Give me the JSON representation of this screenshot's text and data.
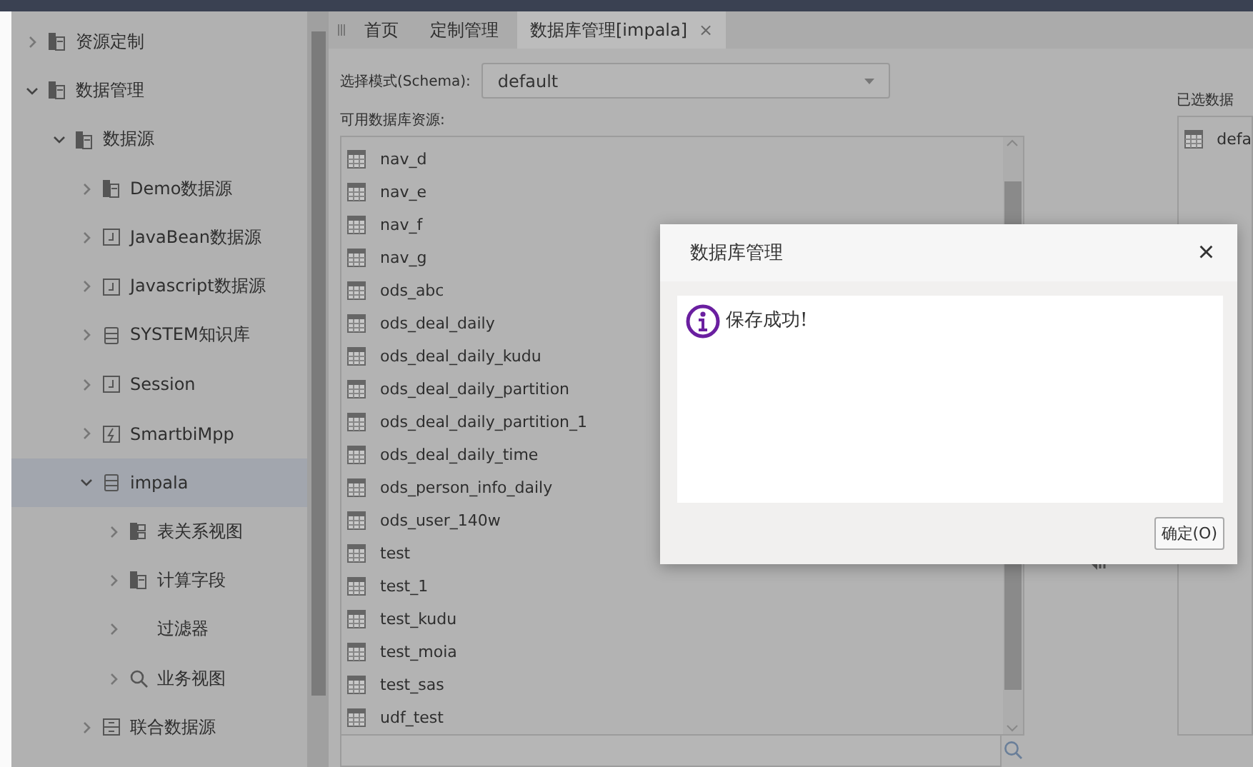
{
  "tree": [
    {
      "label": "资源定制",
      "kind": "folder",
      "expanded": false,
      "selected": false
    },
    {
      "label": "数据管理",
      "kind": "folder",
      "expanded": true,
      "selected": false,
      "children": [
        {
          "label": "数据源",
          "kind": "folder",
          "expanded": true,
          "selected": false,
          "children": [
            {
              "label": "Demo数据源",
              "kind": "folder",
              "expanded": false,
              "selected": false
            },
            {
              "label": "JavaBean数据源",
              "kind": "code",
              "expanded": false,
              "selected": false
            },
            {
              "label": "Javascript数据源",
              "kind": "code",
              "expanded": false,
              "selected": false
            },
            {
              "label": "SYSTEM知识库",
              "kind": "db",
              "expanded": false,
              "selected": false
            },
            {
              "label": "Session",
              "kind": "code",
              "expanded": false,
              "selected": false
            },
            {
              "label": "SmartbiMpp",
              "kind": "bolt",
              "expanded": false,
              "selected": false
            },
            {
              "label": "impala",
              "kind": "db",
              "expanded": true,
              "selected": true,
              "children": [
                {
                  "label": "表关系视图",
                  "kind": "relation",
                  "expanded": false,
                  "selected": false
                },
                {
                  "label": "计算字段",
                  "kind": "folder",
                  "expanded": false,
                  "selected": false
                },
                {
                  "label": "过滤器",
                  "kind": "plain",
                  "expanded": false,
                  "selected": false
                },
                {
                  "label": "业务视图",
                  "kind": "search",
                  "expanded": false,
                  "selected": false
                }
              ]
            },
            {
              "label": "联合数据源",
              "kind": "union",
              "expanded": false,
              "selected": false
            }
          ]
        }
      ]
    }
  ],
  "tabs": [
    {
      "label": "首页",
      "selected": false
    },
    {
      "label": "定制管理",
      "selected": false
    },
    {
      "label": "数据库管理[impala]",
      "selected": true,
      "close": "×"
    }
  ],
  "schema": {
    "label": "选择模式(Schema):",
    "value": "default"
  },
  "available": {
    "label": "可用数据库资源:",
    "items": [
      "nav_d",
      "nav_e",
      "nav_f",
      "nav_g",
      "ods_abc",
      "ods_deal_daily",
      "ods_deal_daily_kudu",
      "ods_deal_daily_partition",
      "ods_deal_daily_partition_1",
      "ods_deal_daily_time",
      "ods_person_info_daily",
      "ods_user_140w",
      "test",
      "test_1",
      "test_kudu",
      "test_moia",
      "test_sas",
      "udf_test"
    ]
  },
  "selected_resources": {
    "label": "已选数据",
    "items": [
      "defa"
    ]
  },
  "dialog": {
    "title": "数据库管理",
    "close": "×",
    "message": "保存成功!",
    "button": "确定(O)"
  }
}
